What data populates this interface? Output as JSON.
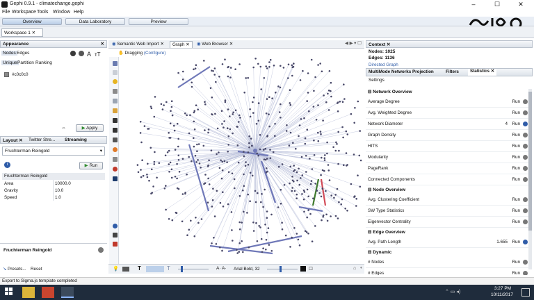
{
  "window": {
    "title": "Gephi 0.9.1 - climatechange.gephi",
    "controls": [
      "–",
      "☐",
      "✕"
    ]
  },
  "menu": [
    "File",
    "Workspace",
    "Tools",
    "Window",
    "Help"
  ],
  "nav": {
    "tabs": [
      "Overview",
      "Data Laboratory",
      "Preview"
    ],
    "active": "Overview"
  },
  "workspace_tab": "Workspace 1",
  "appearance": {
    "title": "Appearance",
    "tabs": [
      "Nodes",
      "Edges"
    ],
    "modes": [
      "Unique",
      "Partition",
      "Ranking"
    ],
    "color_value": "#c0c0c0",
    "apply_label": "Apply"
  },
  "layout": {
    "tabs": [
      "Layout",
      "Twitter Stre...",
      "Streaming"
    ],
    "selected": "Fruchterman Reingold",
    "run_label": "Run",
    "section": "Fruchterman Reingold",
    "props": [
      {
        "name": "Area",
        "value": "10000.0"
      },
      {
        "name": "Gravity",
        "value": "10.0"
      },
      {
        "name": "Speed",
        "value": "1.0"
      }
    ],
    "desc_title": "Fruchterman Reingold",
    "presets_label": "Presets...",
    "reset_label": "Reset"
  },
  "graph": {
    "tabs": [
      "Semantic Web Import",
      "Graph",
      "Web Browser"
    ],
    "mode_label": "Dragging",
    "configure_label": "(Configure)",
    "font_label": "Arial Bold, 32"
  },
  "context": {
    "title": "Context",
    "nodes_label": "Nodes:",
    "nodes_value": "1025",
    "edges_label": "Edges:",
    "edges_value": "1136",
    "graph_type": "Directed Graph"
  },
  "stats_panel": {
    "tabs": [
      "MultiMode Networks Projection",
      "Filters",
      "Statistics"
    ],
    "settings_label": "Settings",
    "sections": [
      {
        "title": "Network Overview",
        "rows": [
          {
            "label": "Average Degree",
            "value": ""
          },
          {
            "label": "Avg. Weighted Degree",
            "value": ""
          },
          {
            "label": "Network Diameter",
            "value": "4"
          },
          {
            "label": "Graph Density",
            "value": ""
          },
          {
            "label": "HITS",
            "value": ""
          },
          {
            "label": "Modularity",
            "value": ""
          },
          {
            "label": "PageRank",
            "value": ""
          },
          {
            "label": "Connected Components",
            "value": ""
          }
        ]
      },
      {
        "title": "Node Overview",
        "rows": [
          {
            "label": "Avg. Clustering Coefficient",
            "value": ""
          },
          {
            "label": "SW Type Statistics",
            "value": ""
          },
          {
            "label": "Eigenvector Centrality",
            "value": ""
          }
        ]
      },
      {
        "title": "Edge Overview",
        "rows": [
          {
            "label": "Avg. Path Length",
            "value": "1.655"
          }
        ]
      },
      {
        "title": "Dynamic",
        "rows": [
          {
            "label": "# Nodes",
            "value": ""
          },
          {
            "label": "# Edges",
            "value": ""
          }
        ]
      }
    ],
    "run_label": "Run"
  },
  "status_message": "Export to Sigma.js template completed",
  "clock": {
    "time": "3:27 PM",
    "date": "10/11/2017"
  },
  "colors": {
    "node": "#4a4a6a",
    "edge": "#b9bfd9",
    "edge_strong": "#6f78b8",
    "arrow_green": "#3f7a2e",
    "arrow_red": "#d24a57",
    "taskbar": "#1f2c3c"
  }
}
